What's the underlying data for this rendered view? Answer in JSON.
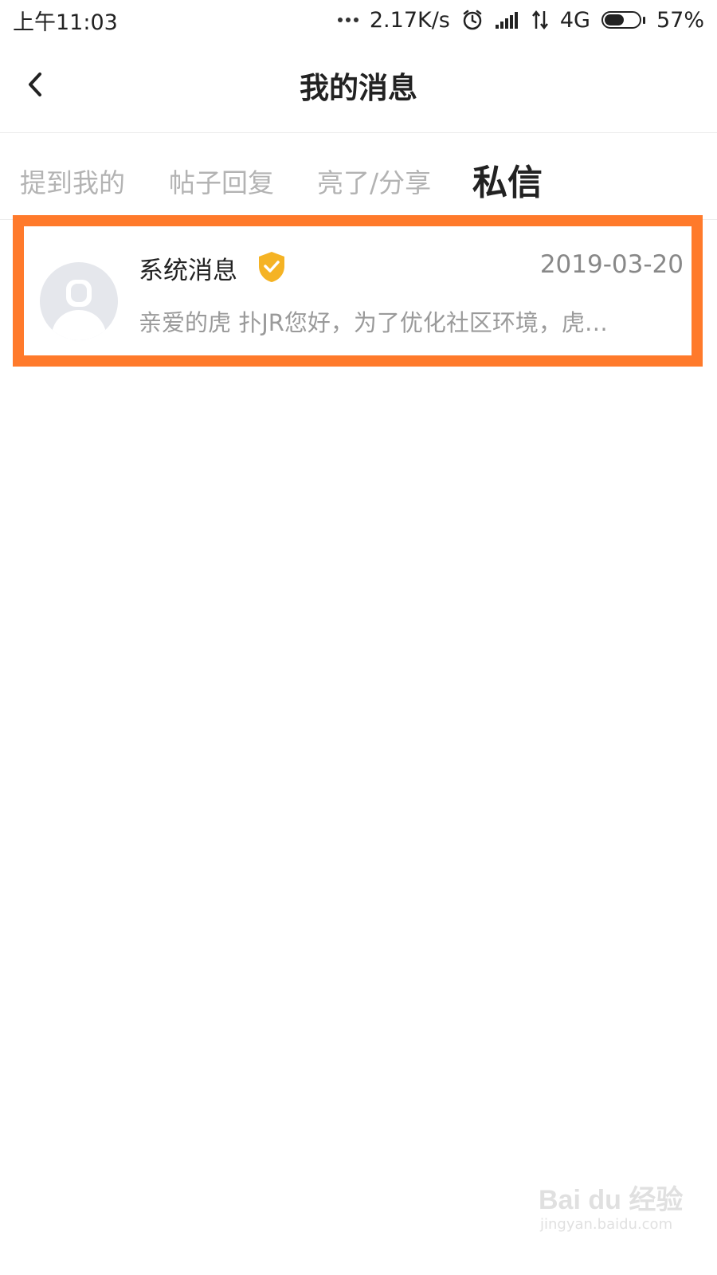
{
  "status_bar": {
    "time": "上午11:03",
    "net_speed": "2.17K/s",
    "network_type": "4G",
    "battery_percent": "57%",
    "battery_level": 0.57,
    "icons": [
      "more-dots-icon",
      "alarm-icon",
      "signal-icon",
      "data-arrows-icon",
      "battery-icon"
    ]
  },
  "header": {
    "title": "我的消息",
    "back_icon": "chevron-left-icon"
  },
  "tabs": [
    {
      "label": "提到我的",
      "active": false
    },
    {
      "label": "帖子回复",
      "active": false
    },
    {
      "label": "亮了/分享",
      "active": false
    },
    {
      "label": "私信",
      "active": true
    }
  ],
  "messages": [
    {
      "sender": "系统消息",
      "verified_icon": "verified-shield-icon",
      "date": "2019-03-20",
      "preview": "亲爱的虎 扑JR您好，为了优化社区环境，虎…"
    }
  ],
  "colors": {
    "highlight": "#ff7a2b",
    "verified": "#f5b324",
    "active_tab": "#222222",
    "inactive_tab": "#b3b3b3"
  },
  "watermark": {
    "logo": "Bai du 经验",
    "url": "jingyan.baidu.com"
  }
}
